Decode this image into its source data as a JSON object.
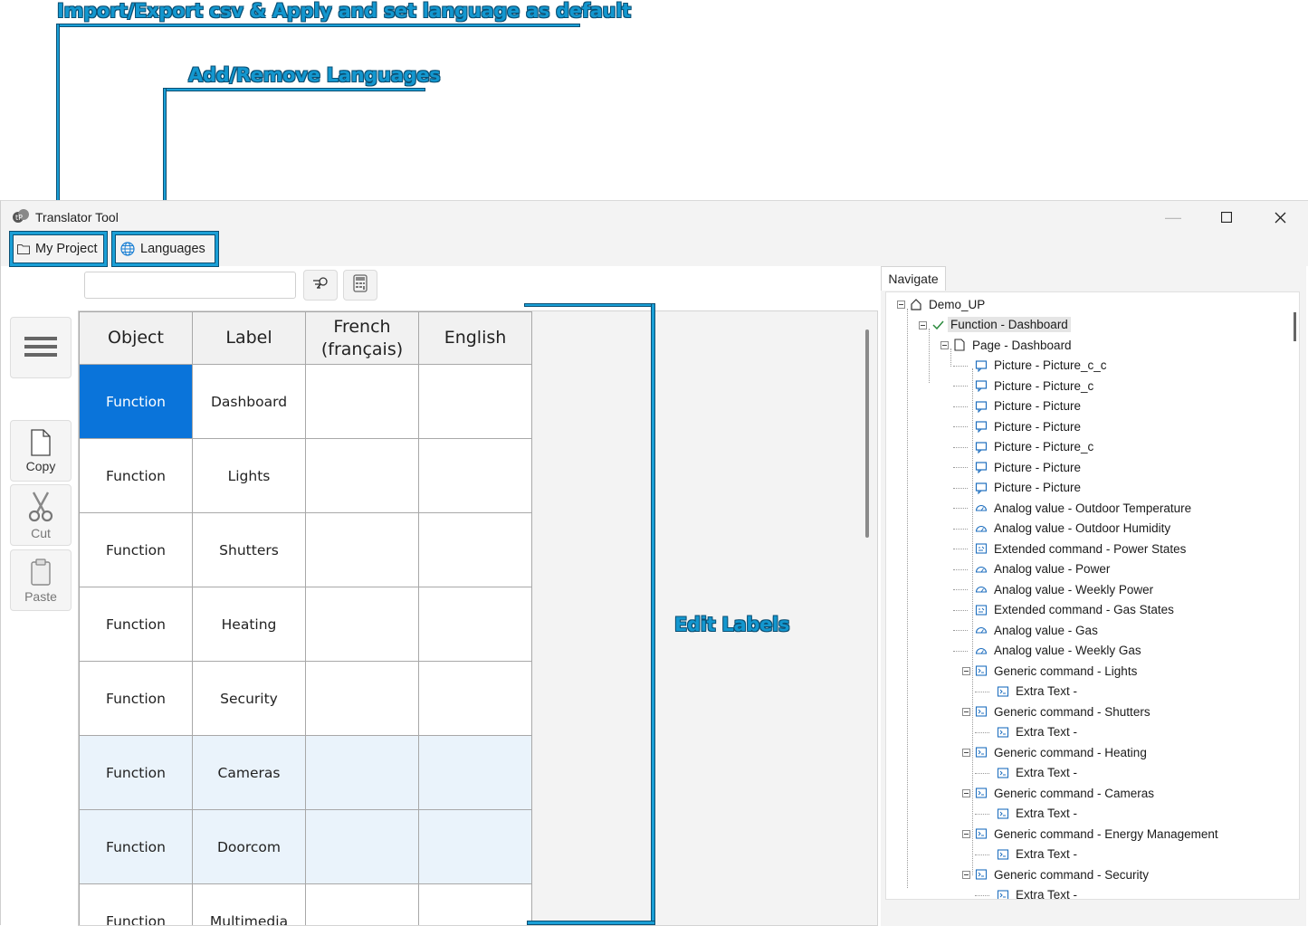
{
  "annotations": {
    "import_export": "Import/Export csv & Apply and set language as default",
    "add_remove": "Add/Remove Languages",
    "edit_labels": "Edit Labels"
  },
  "window": {
    "title": "Translator Tool",
    "controls": {
      "minimize": "—",
      "maximize": "☐",
      "close": "✕"
    }
  },
  "menu": {
    "my_project": "My Project",
    "languages": "Languages"
  },
  "search": {
    "value": ""
  },
  "side_buttons": {
    "copy": "Copy",
    "cut": "Cut",
    "paste": "Paste"
  },
  "grid": {
    "headers": [
      "Object",
      "Label",
      "French (français)",
      "English"
    ],
    "header_french_line1": "French",
    "header_french_line2": "(français)",
    "rows": [
      {
        "object": "Function",
        "label": "Dashboard",
        "french": "",
        "english": ""
      },
      {
        "object": "Function",
        "label": "Lights",
        "french": "",
        "english": ""
      },
      {
        "object": "Function",
        "label": "Shutters",
        "french": "",
        "english": ""
      },
      {
        "object": "Function",
        "label": "Heating",
        "french": "",
        "english": ""
      },
      {
        "object": "Function",
        "label": "Security",
        "french": "",
        "english": ""
      },
      {
        "object": "Function",
        "label": "Cameras",
        "french": "",
        "english": ""
      },
      {
        "object": "Function",
        "label": "Doorcom",
        "french": "",
        "english": ""
      },
      {
        "object": "Function",
        "label": "Multimedia",
        "french": "",
        "english": ""
      }
    ]
  },
  "navigate": {
    "tab": "Navigate",
    "items": [
      {
        "label": "Demo_UP",
        "icon": "home-icon"
      },
      {
        "label": "Function - Dashboard",
        "icon": "check-icon"
      },
      {
        "label": "Page - Dashboard",
        "icon": "page-icon"
      },
      {
        "label": "Picture - Picture_c_c",
        "icon": "picture-icon"
      },
      {
        "label": "Picture - Picture_c",
        "icon": "picture-icon"
      },
      {
        "label": "Picture - Picture",
        "icon": "picture-icon"
      },
      {
        "label": "Picture - Picture",
        "icon": "picture-icon"
      },
      {
        "label": "Picture - Picture_c",
        "icon": "picture-icon"
      },
      {
        "label": "Picture - Picture",
        "icon": "picture-icon"
      },
      {
        "label": "Picture - Picture",
        "icon": "picture-icon"
      },
      {
        "label": "Analog value - Outdoor Temperature",
        "icon": "gauge-icon"
      },
      {
        "label": "Analog value - Outdoor Humidity",
        "icon": "gauge-icon"
      },
      {
        "label": "Extended command - Power States",
        "icon": "extended-command-icon"
      },
      {
        "label": "Analog value - Power",
        "icon": "gauge-icon"
      },
      {
        "label": "Analog value - Weekly Power",
        "icon": "gauge-icon"
      },
      {
        "label": "Extended command - Gas States",
        "icon": "extended-command-icon"
      },
      {
        "label": "Analog value - Gas",
        "icon": "gauge-icon"
      },
      {
        "label": "Analog value - Weekly Gas",
        "icon": "gauge-icon"
      },
      {
        "label": "Generic command - Lights",
        "icon": "command-icon"
      },
      {
        "label": "Extra Text -",
        "icon": "command-icon"
      },
      {
        "label": "Generic command - Shutters",
        "icon": "command-icon"
      },
      {
        "label": "Extra Text -",
        "icon": "command-icon"
      },
      {
        "label": "Generic command - Heating",
        "icon": "command-icon"
      },
      {
        "label": "Extra Text -",
        "icon": "command-icon"
      },
      {
        "label": "Generic command - Cameras",
        "icon": "command-icon"
      },
      {
        "label": "Extra Text -",
        "icon": "command-icon"
      },
      {
        "label": "Generic command - Energy Management",
        "icon": "command-icon"
      },
      {
        "label": "Extra Text -",
        "icon": "command-icon"
      },
      {
        "label": "Generic command - Security",
        "icon": "command-icon"
      },
      {
        "label": "Extra Text -",
        "icon": "command-icon"
      }
    ]
  },
  "colors": {
    "accent": "#0a74da",
    "annotation": "#1a9fd6",
    "annotation_dark": "#0b4f73",
    "row_alt": "#eaf3fb"
  }
}
